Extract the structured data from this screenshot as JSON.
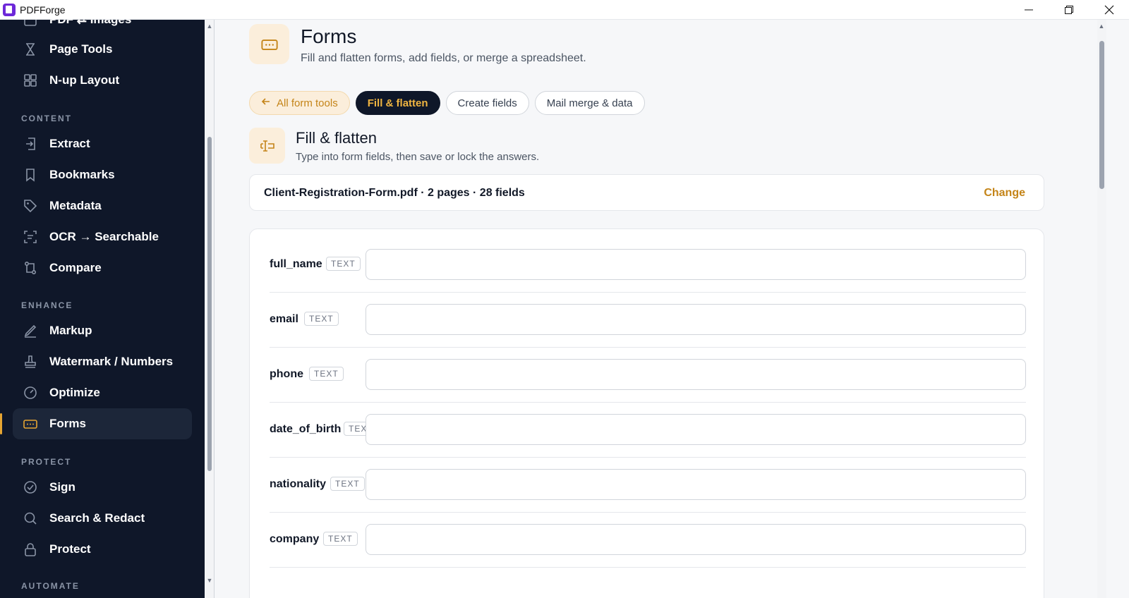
{
  "window": {
    "title": "PDFForge",
    "controls": [
      "minimize-icon",
      "restore-icon",
      "close-icon"
    ]
  },
  "sidebar": {
    "partial_top_item": "PDF ⇄ Images",
    "items_top": [
      {
        "label": "Page Tools",
        "icon": "page-tools-icon"
      },
      {
        "label": "N-up Layout",
        "icon": "grid-icon"
      }
    ],
    "sections": {
      "content": "CONTENT",
      "enhance": "ENHANCE",
      "protect": "PROTECT",
      "automate": "AUTOMATE"
    },
    "content_items": [
      {
        "label": "Extract",
        "icon": "extract-icon"
      },
      {
        "label": "Bookmarks",
        "icon": "bookmark-icon"
      },
      {
        "label": "Metadata",
        "icon": "tag-icon"
      },
      {
        "label": "OCR → Searchable",
        "icon": "scan-icon"
      },
      {
        "label": "Compare",
        "icon": "compare-icon"
      }
    ],
    "enhance_items": [
      {
        "label": "Markup",
        "icon": "markup-icon"
      },
      {
        "label": "Watermark / Numbers",
        "icon": "stamp-icon"
      },
      {
        "label": "Optimize",
        "icon": "gauge-icon"
      },
      {
        "label": "Forms",
        "icon": "forms-icon",
        "active": true
      }
    ],
    "protect_items": [
      {
        "label": "Sign",
        "icon": "sign-icon"
      },
      {
        "label": "Search & Redact",
        "icon": "search-icon"
      },
      {
        "label": "Protect",
        "icon": "lock-icon"
      }
    ],
    "accent": "#e6a532"
  },
  "page": {
    "title": "Forms",
    "subtitle": "Fill and flatten forms, add fields, or merge a spreadsheet.",
    "icon": "forms-icon"
  },
  "tabs": {
    "back_label": "All form tools",
    "items": [
      "Fill & flatten",
      "Create fields",
      "Mail merge & data"
    ],
    "active": "Fill & flatten"
  },
  "section": {
    "title": "Fill & flatten",
    "subtitle": "Type into form fields, then save or lock the answers.",
    "icon": "text-cursor-icon"
  },
  "file": {
    "summary": "Client-Registration-Form.pdf · 2 pages · 28 fields",
    "change_label": "Change"
  },
  "fields": [
    {
      "name": "full_name",
      "type": "TEXT",
      "value": ""
    },
    {
      "name": "email",
      "type": "TEXT",
      "value": ""
    },
    {
      "name": "phone",
      "type": "TEXT",
      "value": ""
    },
    {
      "name": "date_of_birth",
      "type": "TEXT",
      "value": ""
    },
    {
      "name": "nationality",
      "type": "TEXT",
      "value": ""
    },
    {
      "name": "company",
      "type": "TEXT",
      "value": ""
    }
  ],
  "colors": {
    "sidebar_bg": "#0f1729",
    "accent": "#c48418",
    "active_pill_text": "#f0b541"
  }
}
